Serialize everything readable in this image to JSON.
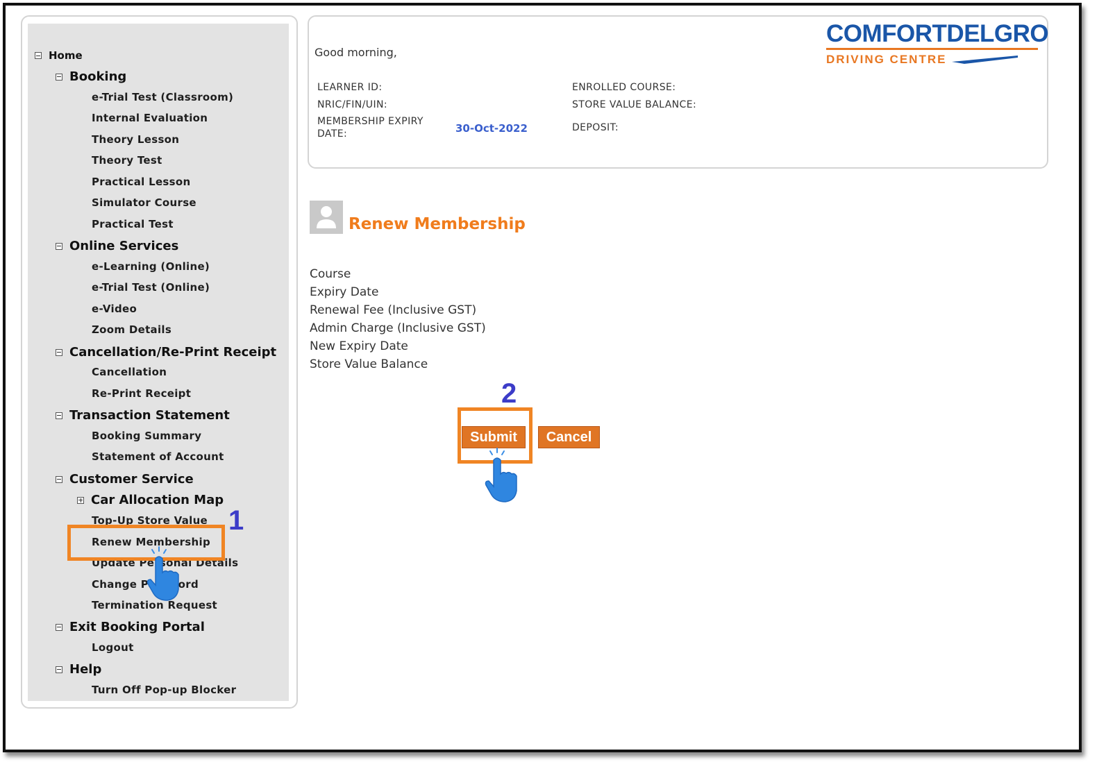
{
  "sidebar": {
    "home": "Home",
    "sections": [
      {
        "label": "Booking",
        "items": [
          "e-Trial Test (Classroom)",
          "Internal Evaluation",
          "Theory Lesson",
          "Theory Test",
          "Practical Lesson",
          "Simulator Course",
          "Practical Test"
        ]
      },
      {
        "label": "Online Services",
        "items": [
          "e-Learning (Online)",
          "e-Trial Test (Online)",
          "e-Video",
          "Zoom Details"
        ]
      },
      {
        "label": "Cancellation/Re-Print Receipt",
        "items": [
          "Cancellation",
          "Re-Print Receipt"
        ]
      },
      {
        "label": "Transaction Statement",
        "items": [
          "Booking Summary",
          "Statement of Account"
        ]
      },
      {
        "label": "Customer Service",
        "expandable": "Car Allocation Map",
        "items": [
          "Top-Up Store Value",
          "Renew Membership",
          "Update Personal Details",
          "Change Password",
          "Termination Request"
        ]
      },
      {
        "label": "Exit Booking Portal",
        "items": [
          "Logout"
        ]
      },
      {
        "label": "Help",
        "items": [
          "Turn Off Pop-up Blocker"
        ]
      }
    ]
  },
  "header": {
    "greeting": "Good morning,",
    "learner_id_label": "LEARNER ID:",
    "nric_label": "NRIC/FIN/UIN:",
    "membership_expiry_label_1": "MEMBERSHIP EXPIRY",
    "membership_expiry_label_2": "DATE:",
    "membership_expiry_value": "30-Oct-2022",
    "enrolled_course_label": "ENROLLED COURSE:",
    "store_value_label": "STORE VALUE BALANCE:",
    "deposit_label": "DEPOSIT:",
    "logo_main": "COMFORTDELGRO",
    "logo_sub": "DRIVING CENTRE"
  },
  "main": {
    "title": "Renew Membership",
    "fields": [
      "Course",
      "Expiry Date",
      "Renewal Fee (Inclusive GST)",
      "Admin Charge (Inclusive GST)",
      "New Expiry Date",
      "Store Value Balance"
    ],
    "submit_label": "Submit",
    "cancel_label": "Cancel"
  },
  "annotations": {
    "step1": "1",
    "step2": "2",
    "highlight_color": "#f08524",
    "step_color": "#3c3cc8"
  }
}
